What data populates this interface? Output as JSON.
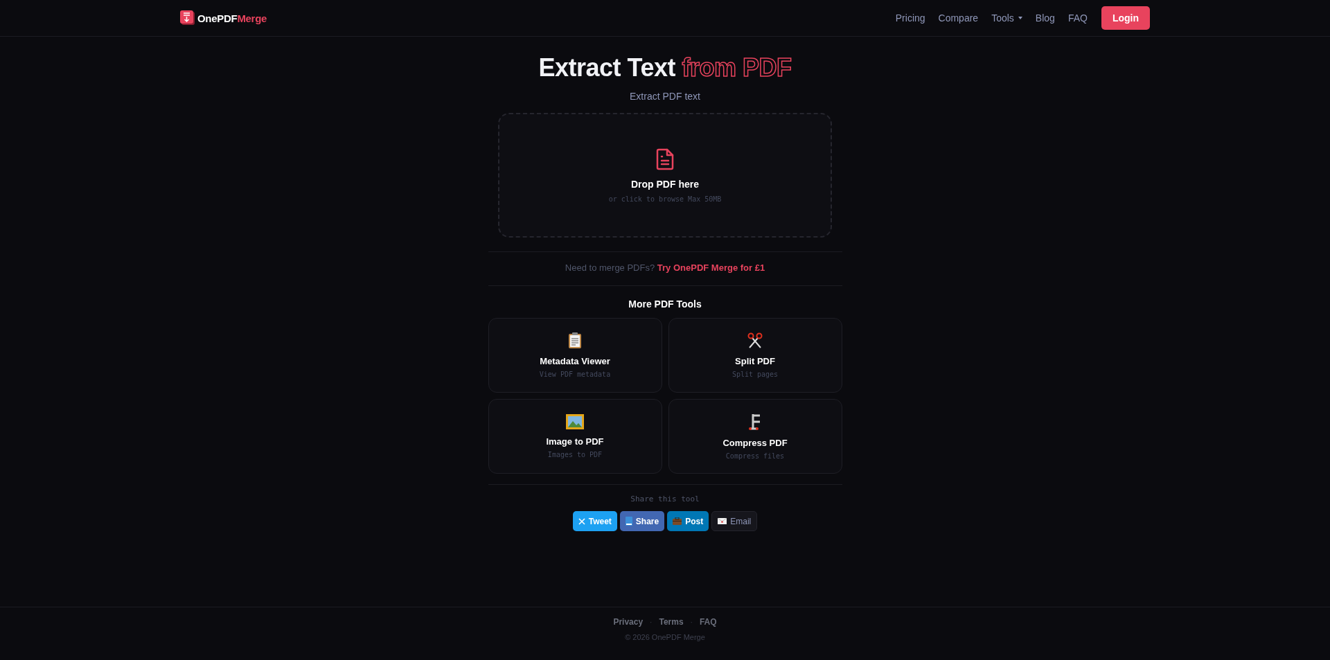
{
  "header": {
    "logo": {
      "part1": "OnePDF",
      "part2": "Merge"
    },
    "nav": [
      {
        "label": "Pricing",
        "kind": "link"
      },
      {
        "label": "Compare",
        "kind": "link"
      },
      {
        "label": "Tools",
        "kind": "dropdown"
      },
      {
        "label": "Blog",
        "kind": "link"
      },
      {
        "label": "FAQ",
        "kind": "link"
      }
    ],
    "login": "Login"
  },
  "hero": {
    "title": "Extract Text",
    "title_accent": "from PDF",
    "subtitle": "Extract PDF text"
  },
  "dropzone": {
    "title": "Drop PDF here",
    "hint": "or click to browse Max 50MB"
  },
  "promo": {
    "text": "Need to merge PDFs?",
    "link": "Try OnePDF Merge for £1"
  },
  "more_tools": {
    "heading": "More PDF Tools",
    "cards": [
      {
        "kind": "clipboard",
        "title": "Metadata Viewer",
        "description": "View PDF metadata"
      },
      {
        "kind": "scissors",
        "title": "Split PDF",
        "description": "Split pages"
      },
      {
        "kind": "picture",
        "title": "Image to PDF",
        "description": "Images to PDF"
      },
      {
        "kind": "clamp",
        "title": "Compress PDF",
        "description": "Compress files"
      }
    ]
  },
  "share": {
    "heading": "Share this tool",
    "buttons": [
      {
        "kind": "x",
        "label": "Tweet",
        "color": "#1da1f2"
      },
      {
        "kind": "book",
        "label": "Share",
        "color": "#4267b2"
      },
      {
        "kind": "briefcase",
        "label": "Post",
        "color": "#0077b5"
      },
      {
        "kind": "envelope",
        "label": "Email",
        "color": "#16161c"
      }
    ]
  },
  "footer": {
    "links": [
      "Privacy",
      "Terms",
      "FAQ"
    ],
    "separator": "·",
    "copyright": "© 2026 OnePDF Merge"
  }
}
